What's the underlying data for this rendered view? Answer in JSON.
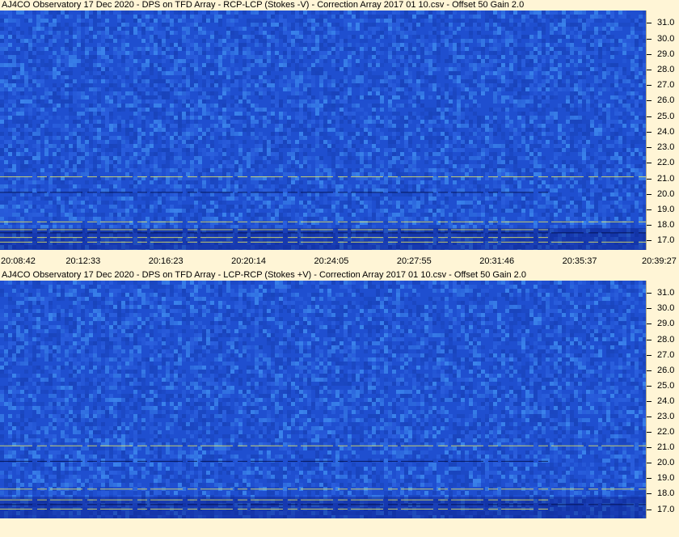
{
  "panels": [
    {
      "title": "AJ4CO Observatory 17 Dec 2020  -  DPS on TFD Array  -  RCP-LCP (Stokes -V)  -  Correction Array 2017 01 10.csv  -  Offset 50  Gain 2.0"
    },
    {
      "title": "AJ4CO Observatory 17 Dec 2020  -  DPS on TFD Array  -  LCP-RCP (Stokes +V)  -  Correction Array 2017 01 10.csv  -  Offset 50  Gain 2.0"
    }
  ],
  "time_axis": {
    "labels": [
      "20:08:42",
      "20:12:33",
      "20:16:23",
      "20:20:14",
      "20:24:05",
      "20:27:55",
      "20:31:46",
      "20:35:37",
      "20:39:27"
    ]
  },
  "colors": {
    "background": "#fff5d6",
    "spectrogram_base": "#1f4fd0",
    "spectrogram_dark": "#0a1f8a",
    "spectrogram_light": "#3f8cf0",
    "interference": "#f0f060"
  },
  "chart_data": [
    {
      "type": "heatmap",
      "title": "AJ4CO Observatory 17 Dec 2020  -  DPS on TFD Array  -  RCP-LCP (Stokes -V)  -  Correction Array 2017 01 10.csv  -  Offset 50  Gain 2.0",
      "x_start": "20:08:42",
      "x_end": "20:39:27",
      "x_ticks": [
        "20:08:42",
        "20:12:33",
        "20:16:23",
        "20:20:14",
        "20:24:05",
        "20:27:55",
        "20:31:46",
        "20:35:37",
        "20:39:27"
      ],
      "y_ticks": [
        31.0,
        30.0,
        29.0,
        28.0,
        27.0,
        26.0,
        25.0,
        24.0,
        23.0,
        22.0,
        21.0,
        20.0,
        19.0,
        18.0,
        17.0
      ],
      "ylim": [
        16.4,
        31.8
      ],
      "interference_lines_mhz": [
        21.1,
        20.1,
        18.2,
        17.7,
        17.5,
        17.2,
        16.9
      ],
      "colormap": "blue"
    },
    {
      "type": "heatmap",
      "title": "AJ4CO Observatory 17 Dec 2020  -  DPS on TFD Array  -  LCP-RCP (Stokes +V)  -  Correction Array 2017 01 10.csv  -  Offset 50  Gain 2.0",
      "x_start": "20:08:42",
      "x_end": "20:39:27",
      "x_ticks": [],
      "y_ticks": [
        31.0,
        30.0,
        29.0,
        28.0,
        27.0,
        26.0,
        25.0,
        24.0,
        23.0,
        22.0,
        21.0,
        20.0,
        19.0,
        18.0,
        17.0
      ],
      "ylim": [
        16.4,
        31.8
      ],
      "interference_lines_mhz": [
        21.1,
        20.1,
        18.3,
        17.6,
        17.3,
        17.0
      ],
      "colormap": "blue"
    }
  ]
}
